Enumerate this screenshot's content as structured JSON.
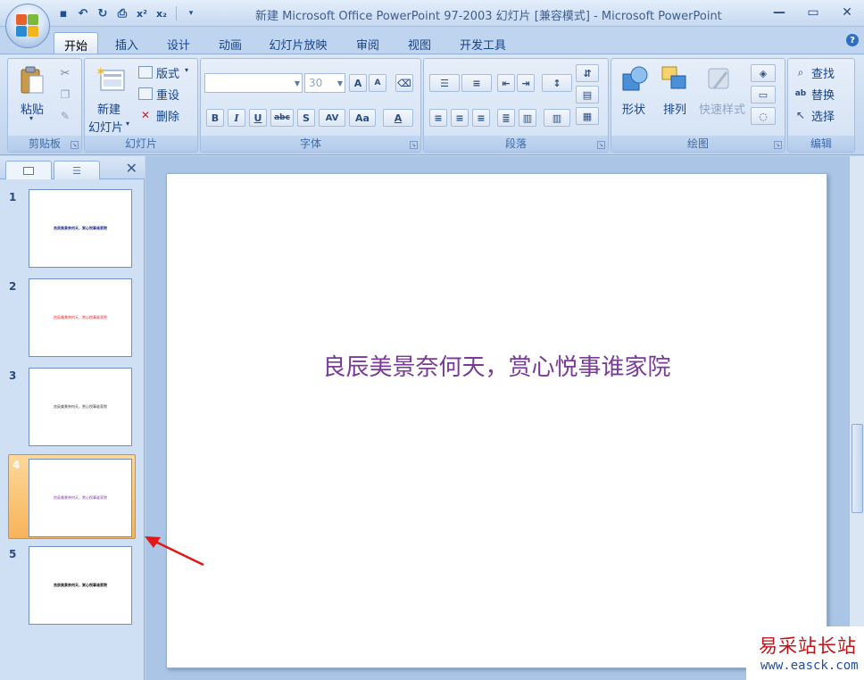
{
  "window": {
    "title": "新建 Microsoft Office PowerPoint 97-2003 幻灯片 [兼容模式] - Microsoft PowerPoint",
    "qat": [
      "save-icon",
      "undo-icon",
      "redo-icon",
      "print-preview-icon",
      "superscript-icon",
      "subscript-icon",
      "customize-icon"
    ],
    "controls": {
      "minimize": "—",
      "maximize": "▭",
      "close": "✕"
    }
  },
  "ribbon": {
    "tabs": [
      "开始",
      "插入",
      "设计",
      "动画",
      "幻灯片放映",
      "审阅",
      "视图",
      "开发工具"
    ],
    "active_tab": "开始",
    "groups": {
      "clipboard": {
        "label": "剪贴板",
        "paste": "粘贴"
      },
      "slides": {
        "label": "幻灯片",
        "new_slide_line1": "新建",
        "new_slide_line2": "幻灯片",
        "layout": "版式",
        "reset": "重设",
        "delete": "删除"
      },
      "font": {
        "label": "字体",
        "font_name": "",
        "font_size": "30",
        "bold": "B",
        "italic": "I",
        "underline": "U",
        "strike": "abc",
        "shadow": "S",
        "spacing": "AV",
        "case": "Aa",
        "color": "A",
        "grow": "A",
        "shrink": "A"
      },
      "paragraph": {
        "label": "段落"
      },
      "drawing": {
        "label": "绘图",
        "shapes": "形状",
        "arrange": "排列",
        "quick_styles": "快速样式"
      },
      "editing": {
        "label": "编辑",
        "find": "查找",
        "replace": "替换",
        "select": "选择"
      }
    }
  },
  "slide_pane": {
    "slides": [
      {
        "num": "1",
        "text": "良辰美景奈何天，赏心悦事谁家院",
        "color": "#1f2f8a"
      },
      {
        "num": "2",
        "text": "良辰美景奈何天，赏心悦事谁家院",
        "color": "#e02020"
      },
      {
        "num": "3",
        "text": "良辰美景奈何天，赏心悦事谁家院",
        "color": "#333333"
      },
      {
        "num": "4",
        "text": "良辰美景奈何天，赏心悦事谁家院",
        "color": "#7a3a9a"
      },
      {
        "num": "5",
        "text": "良辰美景奈何天，赏心悦事谁家院",
        "color": "#111111"
      }
    ],
    "selected": "4"
  },
  "main_slide": {
    "text": "良辰美景奈何天，赏心悦事谁家院",
    "color": "#7a3a9a"
  },
  "watermark": {
    "main": "易采站长站",
    "sub": "www.easck.com"
  }
}
